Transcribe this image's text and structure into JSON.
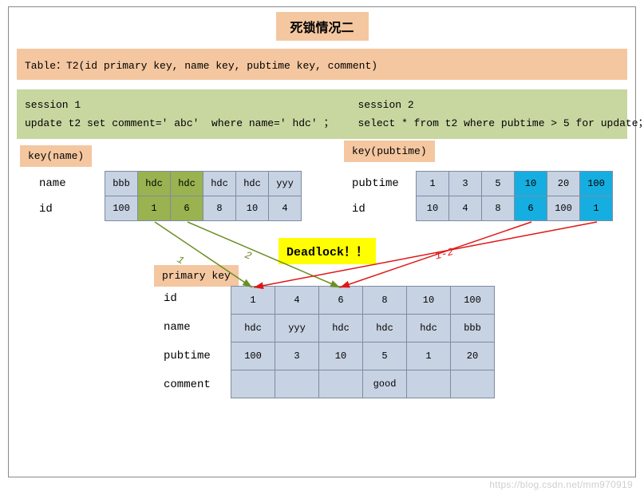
{
  "title": "死锁情况二",
  "schema": "Table：T2(id primary key, name key, pubtime key, comment)",
  "session1": {
    "title": "session 1",
    "sql": "update t2 set comment=' abc'  where name=' hdc' ；"
  },
  "session2": {
    "title": "session 2",
    "sql": "select * from t2 where pubtime > 5 for update；"
  },
  "tags": {
    "key_name": "key(name)",
    "key_pubtime": "key(pubtime)",
    "primary_key": "primary key"
  },
  "name_index": {
    "row1_label": "name",
    "row2_label": "id",
    "names": [
      "bbb",
      "hdc",
      "hdc",
      "hdc",
      "hdc",
      "yyy"
    ],
    "ids": [
      "100",
      "1",
      "6",
      "8",
      "10",
      "4"
    ],
    "highlight": [
      1,
      2
    ]
  },
  "pubtime_index": {
    "row1_label": "pubtime",
    "row2_label": "id",
    "pubtimes": [
      "1",
      "3",
      "5",
      "10",
      "20",
      "100"
    ],
    "ids": [
      "10",
      "4",
      "8",
      "6",
      "100",
      "1"
    ],
    "highlight": [
      3,
      5
    ]
  },
  "deadlock_label": "Deadlock！！",
  "primary": {
    "labels": [
      "id",
      "name",
      "pubtime",
      "comment"
    ],
    "rows": [
      [
        "1",
        "4",
        "6",
        "8",
        "10",
        "100"
      ],
      [
        "hdc",
        "yyy",
        "hdc",
        "hdc",
        "hdc",
        "bbb"
      ],
      [
        "100",
        "3",
        "10",
        "5",
        "1",
        "20"
      ],
      [
        "",
        "",
        "",
        "good",
        "",
        ""
      ]
    ]
  },
  "arrow_labels": {
    "olive1": "1",
    "olive2": "2",
    "red": "1-2"
  },
  "watermark": "https://blog.csdn.net/mm970919"
}
